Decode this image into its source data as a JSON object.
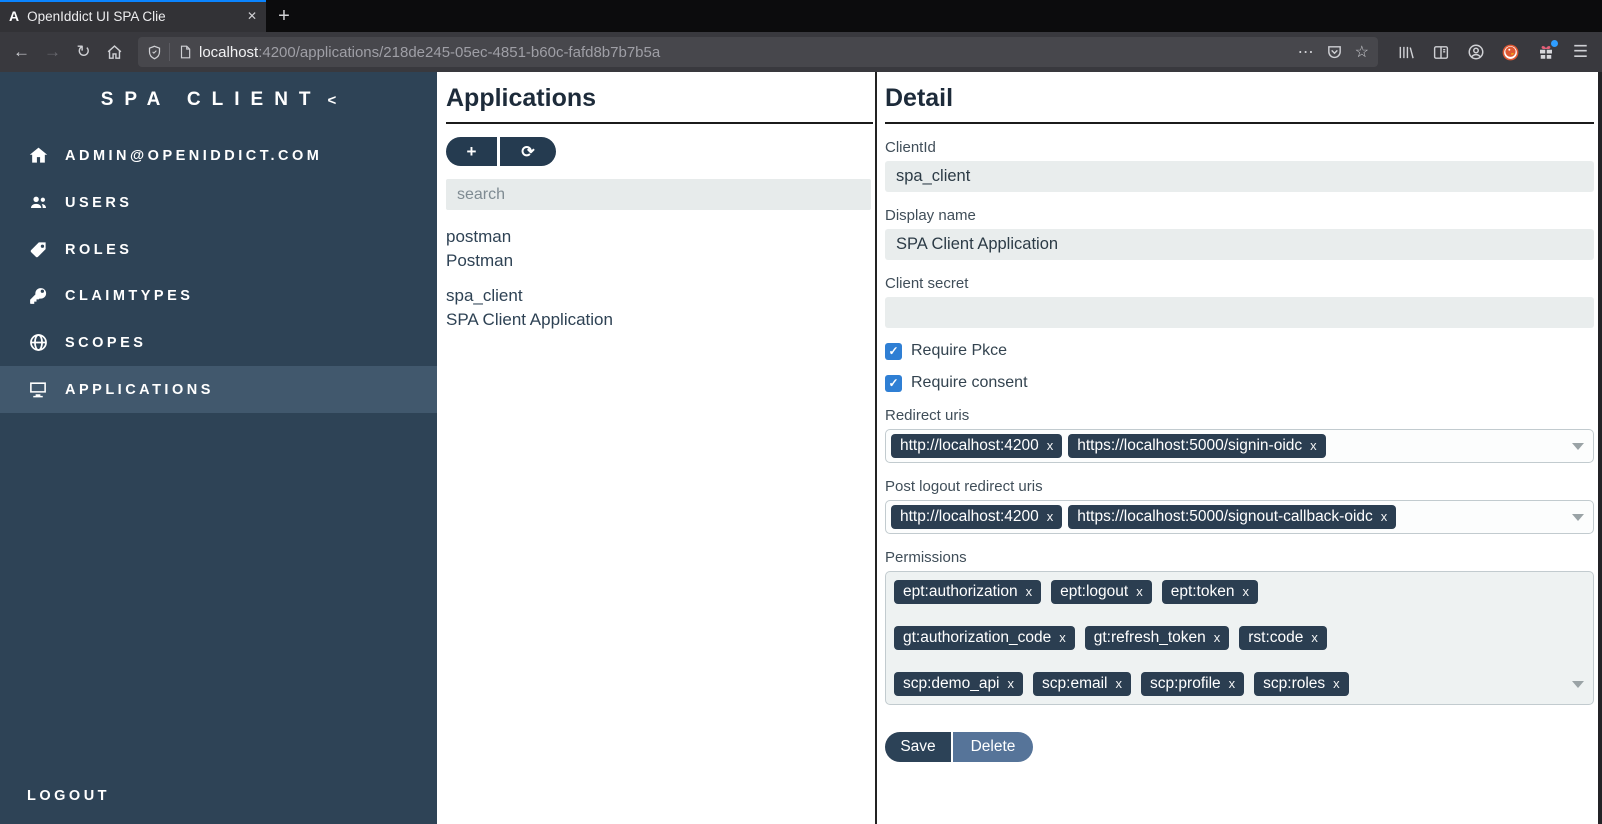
{
  "glyphs": {
    "back": "←",
    "forward": "→",
    "reload": "↻",
    "dots": "⋯",
    "star": "☆",
    "menu": "☰",
    "plus": "+",
    "refresh": "⟳",
    "close": "✕",
    "new_tab": "+",
    "check": "✓",
    "collapse": "<"
  },
  "browser": {
    "tab": {
      "favicon": "A",
      "title": "OpenIddict UI SPA Clie"
    },
    "url_host": "localhost",
    "url_rest": ":4200/applications/218de245-05ec-4851-b60c-fafd8b7b7b5a"
  },
  "sidebar": {
    "title": "SPA CLIENT",
    "items": [
      {
        "label": "ADMIN@OPENIDDICT.COM"
      },
      {
        "label": "USERS"
      },
      {
        "label": "ROLES"
      },
      {
        "label": "CLAIMTYPES"
      },
      {
        "label": "SCOPES"
      },
      {
        "label": "APPLICATIONS"
      }
    ],
    "logout_label": "LOGOUT"
  },
  "apps": {
    "title": "Applications",
    "search_placeholder": "search",
    "items": [
      {
        "client_id": "postman",
        "display_name": "Postman"
      },
      {
        "client_id": "spa_client",
        "display_name": "SPA Client Application"
      }
    ]
  },
  "detail": {
    "title": "Detail",
    "fields": {
      "client_id": {
        "label": "ClientId",
        "value": "spa_client"
      },
      "display_name": {
        "label": "Display name",
        "value": "SPA Client Application"
      },
      "client_secret": {
        "label": "Client secret",
        "value": ""
      }
    },
    "checkboxes": [
      {
        "label": "Require Pkce",
        "checked": true
      },
      {
        "label": "Require consent",
        "checked": true
      }
    ],
    "redirect_uris": {
      "label": "Redirect uris",
      "tags": [
        "http://localhost:4200",
        "https://localhost:5000/signin-oidc"
      ]
    },
    "post_logout_redirect_uris": {
      "label": "Post logout redirect uris",
      "tags": [
        "http://localhost:4200",
        "https://localhost:5000/signout-callback-oidc"
      ]
    },
    "permissions": {
      "label": "Permissions",
      "tags": [
        "ept:authorization",
        "ept:logout",
        "ept:token",
        "gt:authorization_code",
        "gt:refresh_token",
        "rst:code",
        "scp:demo_api",
        "scp:email",
        "scp:profile",
        "scp:roles"
      ]
    },
    "tag_remove_glyph": "x",
    "save_label": "Save",
    "delete_label": "Delete"
  },
  "colors": {
    "tab_accent": "#0a84ff",
    "sidebar_bg": "#2e4356",
    "sidebar_active_bg": "#41586d",
    "tag_bg": "#2b3e51",
    "checkbox_blue": "#2f7fd4",
    "save_bg": "#2c4257",
    "delete_bg": "#567499",
    "input_bg": "#e9eded"
  }
}
